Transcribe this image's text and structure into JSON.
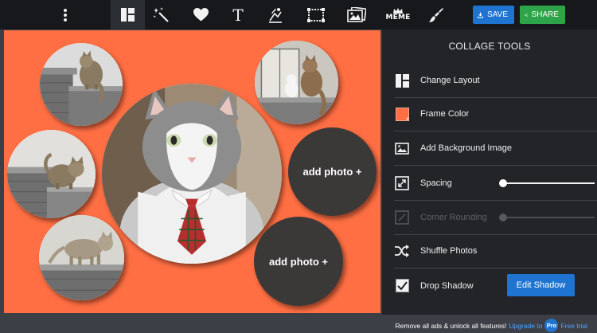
{
  "toolbar": {
    "tools": [
      {
        "icon": "more-vertical-icon"
      },
      {
        "icon": "layout-icon",
        "active": true
      },
      {
        "icon": "magic-wand-icon"
      },
      {
        "icon": "heart-icon"
      },
      {
        "icon": "text-icon"
      },
      {
        "icon": "clipart-icon"
      },
      {
        "icon": "frame-icon"
      },
      {
        "icon": "photo-icon"
      },
      {
        "icon": "meme-icon"
      },
      {
        "icon": "paintbrush-icon"
      }
    ],
    "text_tool_glyph": "T",
    "meme_label": "MEME",
    "save_label": "SAVE",
    "share_label": "SHARE"
  },
  "canvas": {
    "background_color": "#ff6f43",
    "slots": [
      {
        "name": "photo-cat-on-wall-top-left",
        "filled": true
      },
      {
        "name": "photo-main-cat-with-tie",
        "filled": true
      },
      {
        "name": "photo-cats-window",
        "filled": true
      },
      {
        "name": "photo-cat-on-wall-middle-left",
        "filled": true
      },
      {
        "name": "photo-cat-walking-bottom-left",
        "filled": true
      },
      {
        "name": "empty-slot-right",
        "filled": false,
        "label": "add photo +"
      },
      {
        "name": "empty-slot-bottom",
        "filled": false,
        "label": "add photo +"
      }
    ]
  },
  "panel": {
    "title": "COLLAGE TOOLS",
    "items": [
      {
        "label": "Change Layout",
        "icon": "layout-icon",
        "enabled": true
      },
      {
        "label": "Frame Color",
        "icon": "color-swatch-icon",
        "enabled": true,
        "swatch_color": "#ff6f43"
      },
      {
        "label": "Add Background Image",
        "icon": "image-icon",
        "enabled": true
      },
      {
        "label": "Spacing",
        "icon": "resize-icon",
        "enabled": true,
        "slider_value": 0
      },
      {
        "label": "Corner Rounding",
        "icon": "corner-icon",
        "enabled": false,
        "slider_value": 0
      },
      {
        "label": "Shuffle Photos",
        "icon": "shuffle-icon",
        "enabled": true
      },
      {
        "label": "Drop Shadow",
        "icon": "checkbox-icon",
        "enabled": true,
        "checked": true,
        "button_label": "Edit Shadow"
      }
    ]
  },
  "footer": {
    "message": "Remove all ads & unlock all features!",
    "upgrade_link": "Upgrade to",
    "pro_badge": "Pro",
    "trial_link": "Free trial"
  },
  "colors": {
    "accent_blue": "#1e74d0",
    "share_green": "#2da44a",
    "toolbar_bg": "#16181b",
    "panel_bg": "#222427"
  }
}
